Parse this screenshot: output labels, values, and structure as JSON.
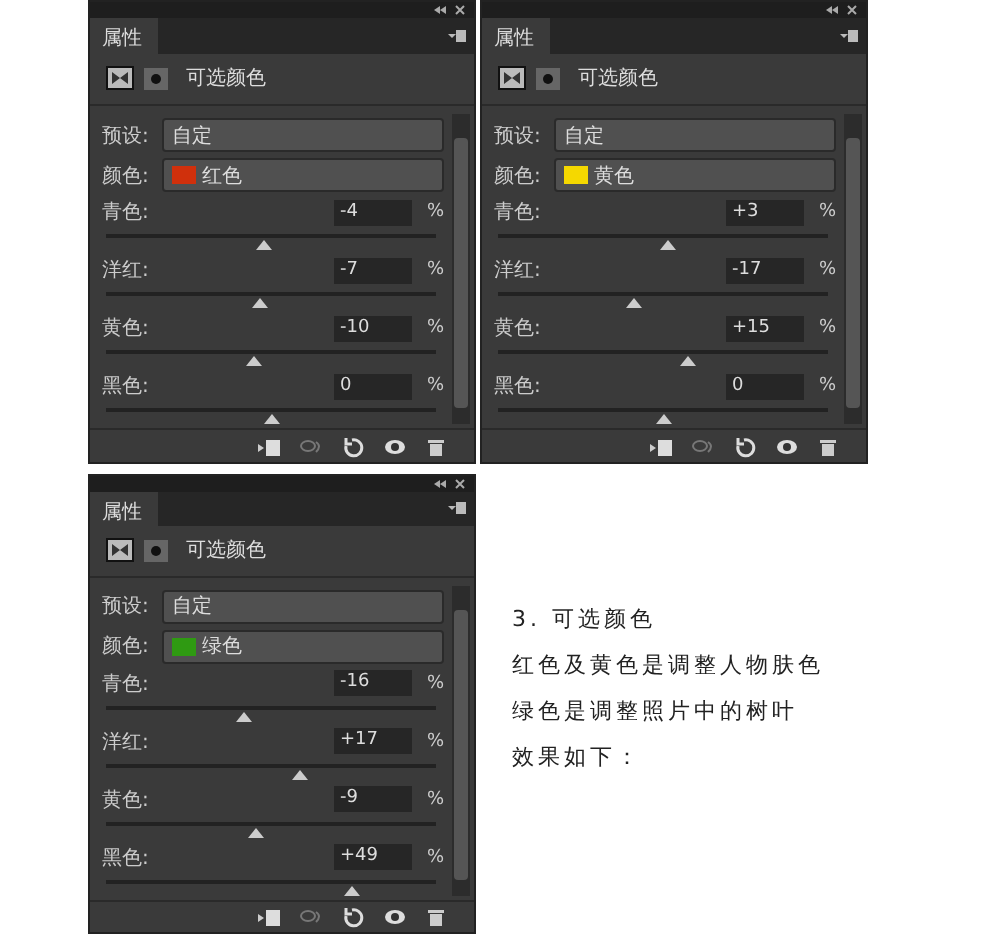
{
  "panels": [
    {
      "tab": "属性",
      "title": "可选颜色",
      "preset_label": "预设:",
      "preset": "自定",
      "color_label": "颜色:",
      "color_value": "红色",
      "color": "#d0300c",
      "sliders": [
        {
          "label": "青色:",
          "value": "-4",
          "unit": "%",
          "level": 0.48
        },
        {
          "label": "洋红:",
          "value": "-7",
          "unit": "%",
          "level": 0.465
        },
        {
          "label": "黄色:",
          "value": "-10",
          "unit": "%",
          "level": 0.45
        },
        {
          "label": "黑色:",
          "value": "0",
          "unit": "%",
          "level": 0.5
        }
      ]
    },
    {
      "tab": "属性",
      "title": "可选颜色",
      "preset_label": "预设:",
      "preset": "自定",
      "color_label": "颜色:",
      "color_value": "黄色",
      "color": "#f5d800",
      "sliders": [
        {
          "label": "青色:",
          "value": "+3",
          "unit": "%",
          "level": 0.515
        },
        {
          "label": "洋红:",
          "value": "-17",
          "unit": "%",
          "level": 0.415
        },
        {
          "label": "黄色:",
          "value": "+15",
          "unit": "%",
          "level": 0.575
        },
        {
          "label": "黑色:",
          "value": "0",
          "unit": "%",
          "level": 0.5
        }
      ]
    },
    {
      "tab": "属性",
      "title": "可选颜色",
      "preset_label": "预设:",
      "preset": "自定",
      "color_label": "颜色:",
      "color_value": "绿色",
      "color": "#2f9a12",
      "sliders": [
        {
          "label": "青色:",
          "value": "-16",
          "unit": "%",
          "level": 0.42
        },
        {
          "label": "洋红:",
          "value": "+17",
          "unit": "%",
          "level": 0.585
        },
        {
          "label": "黄色:",
          "value": "-9",
          "unit": "%",
          "level": 0.455
        },
        {
          "label": "黑色:",
          "value": "+49",
          "unit": "%",
          "level": 0.745
        }
      ]
    }
  ],
  "note": {
    "lines": [
      "3. 可选颜色",
      "红色及黄色是调整人物肤色",
      "绿色是调整照片中的树叶",
      "效果如下："
    ]
  }
}
